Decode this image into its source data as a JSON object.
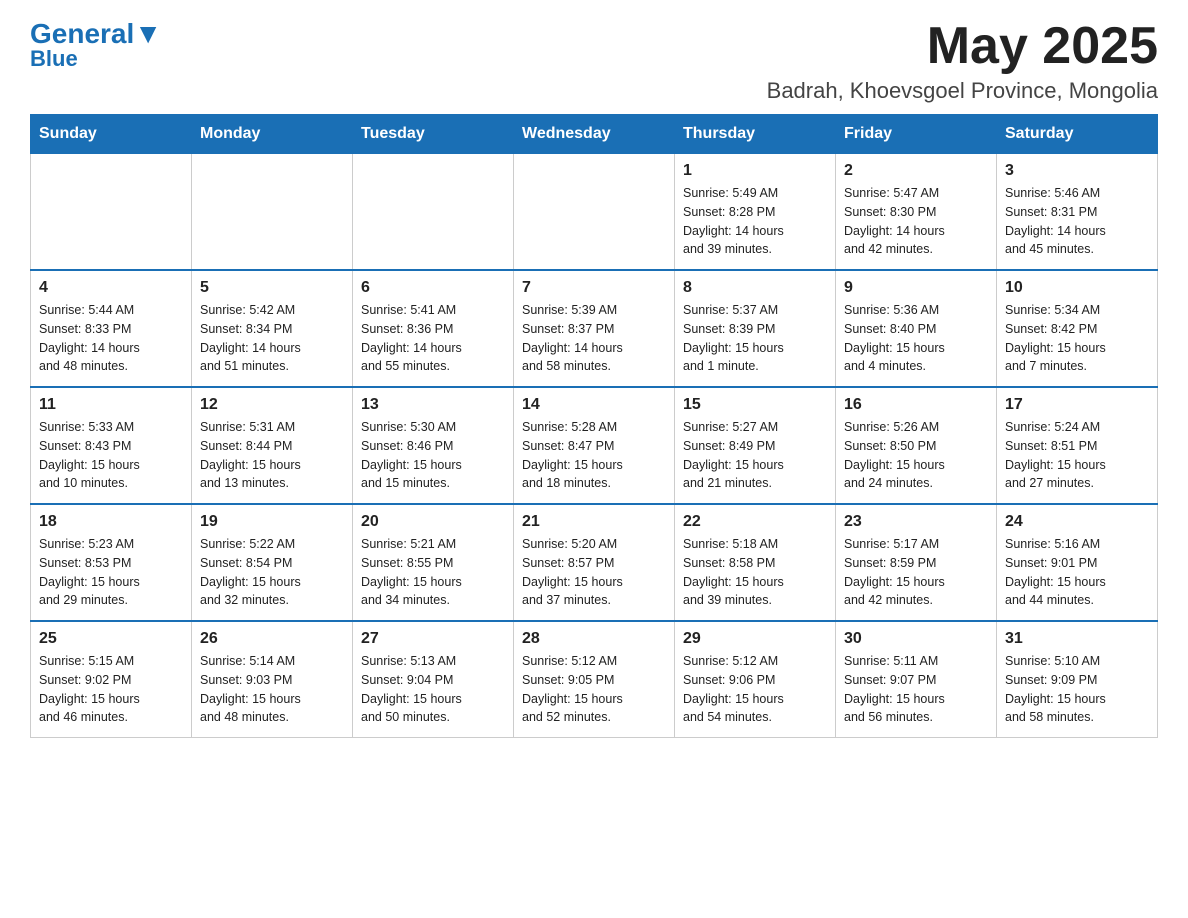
{
  "logo": {
    "general": "General",
    "blue": "Blue",
    "triangle_color": "#1a6fb5"
  },
  "header": {
    "month_title": "May 2025",
    "location": "Badrah, Khoevsgoel Province, Mongolia"
  },
  "weekdays": [
    "Sunday",
    "Monday",
    "Tuesday",
    "Wednesday",
    "Thursday",
    "Friday",
    "Saturday"
  ],
  "weeks": [
    [
      {
        "day": "",
        "info": ""
      },
      {
        "day": "",
        "info": ""
      },
      {
        "day": "",
        "info": ""
      },
      {
        "day": "",
        "info": ""
      },
      {
        "day": "1",
        "info": "Sunrise: 5:49 AM\nSunset: 8:28 PM\nDaylight: 14 hours\nand 39 minutes."
      },
      {
        "day": "2",
        "info": "Sunrise: 5:47 AM\nSunset: 8:30 PM\nDaylight: 14 hours\nand 42 minutes."
      },
      {
        "day": "3",
        "info": "Sunrise: 5:46 AM\nSunset: 8:31 PM\nDaylight: 14 hours\nand 45 minutes."
      }
    ],
    [
      {
        "day": "4",
        "info": "Sunrise: 5:44 AM\nSunset: 8:33 PM\nDaylight: 14 hours\nand 48 minutes."
      },
      {
        "day": "5",
        "info": "Sunrise: 5:42 AM\nSunset: 8:34 PM\nDaylight: 14 hours\nand 51 minutes."
      },
      {
        "day": "6",
        "info": "Sunrise: 5:41 AM\nSunset: 8:36 PM\nDaylight: 14 hours\nand 55 minutes."
      },
      {
        "day": "7",
        "info": "Sunrise: 5:39 AM\nSunset: 8:37 PM\nDaylight: 14 hours\nand 58 minutes."
      },
      {
        "day": "8",
        "info": "Sunrise: 5:37 AM\nSunset: 8:39 PM\nDaylight: 15 hours\nand 1 minute."
      },
      {
        "day": "9",
        "info": "Sunrise: 5:36 AM\nSunset: 8:40 PM\nDaylight: 15 hours\nand 4 minutes."
      },
      {
        "day": "10",
        "info": "Sunrise: 5:34 AM\nSunset: 8:42 PM\nDaylight: 15 hours\nand 7 minutes."
      }
    ],
    [
      {
        "day": "11",
        "info": "Sunrise: 5:33 AM\nSunset: 8:43 PM\nDaylight: 15 hours\nand 10 minutes."
      },
      {
        "day": "12",
        "info": "Sunrise: 5:31 AM\nSunset: 8:44 PM\nDaylight: 15 hours\nand 13 minutes."
      },
      {
        "day": "13",
        "info": "Sunrise: 5:30 AM\nSunset: 8:46 PM\nDaylight: 15 hours\nand 15 minutes."
      },
      {
        "day": "14",
        "info": "Sunrise: 5:28 AM\nSunset: 8:47 PM\nDaylight: 15 hours\nand 18 minutes."
      },
      {
        "day": "15",
        "info": "Sunrise: 5:27 AM\nSunset: 8:49 PM\nDaylight: 15 hours\nand 21 minutes."
      },
      {
        "day": "16",
        "info": "Sunrise: 5:26 AM\nSunset: 8:50 PM\nDaylight: 15 hours\nand 24 minutes."
      },
      {
        "day": "17",
        "info": "Sunrise: 5:24 AM\nSunset: 8:51 PM\nDaylight: 15 hours\nand 27 minutes."
      }
    ],
    [
      {
        "day": "18",
        "info": "Sunrise: 5:23 AM\nSunset: 8:53 PM\nDaylight: 15 hours\nand 29 minutes."
      },
      {
        "day": "19",
        "info": "Sunrise: 5:22 AM\nSunset: 8:54 PM\nDaylight: 15 hours\nand 32 minutes."
      },
      {
        "day": "20",
        "info": "Sunrise: 5:21 AM\nSunset: 8:55 PM\nDaylight: 15 hours\nand 34 minutes."
      },
      {
        "day": "21",
        "info": "Sunrise: 5:20 AM\nSunset: 8:57 PM\nDaylight: 15 hours\nand 37 minutes."
      },
      {
        "day": "22",
        "info": "Sunrise: 5:18 AM\nSunset: 8:58 PM\nDaylight: 15 hours\nand 39 minutes."
      },
      {
        "day": "23",
        "info": "Sunrise: 5:17 AM\nSunset: 8:59 PM\nDaylight: 15 hours\nand 42 minutes."
      },
      {
        "day": "24",
        "info": "Sunrise: 5:16 AM\nSunset: 9:01 PM\nDaylight: 15 hours\nand 44 minutes."
      }
    ],
    [
      {
        "day": "25",
        "info": "Sunrise: 5:15 AM\nSunset: 9:02 PM\nDaylight: 15 hours\nand 46 minutes."
      },
      {
        "day": "26",
        "info": "Sunrise: 5:14 AM\nSunset: 9:03 PM\nDaylight: 15 hours\nand 48 minutes."
      },
      {
        "day": "27",
        "info": "Sunrise: 5:13 AM\nSunset: 9:04 PM\nDaylight: 15 hours\nand 50 minutes."
      },
      {
        "day": "28",
        "info": "Sunrise: 5:12 AM\nSunset: 9:05 PM\nDaylight: 15 hours\nand 52 minutes."
      },
      {
        "day": "29",
        "info": "Sunrise: 5:12 AM\nSunset: 9:06 PM\nDaylight: 15 hours\nand 54 minutes."
      },
      {
        "day": "30",
        "info": "Sunrise: 5:11 AM\nSunset: 9:07 PM\nDaylight: 15 hours\nand 56 minutes."
      },
      {
        "day": "31",
        "info": "Sunrise: 5:10 AM\nSunset: 9:09 PM\nDaylight: 15 hours\nand 58 minutes."
      }
    ]
  ]
}
